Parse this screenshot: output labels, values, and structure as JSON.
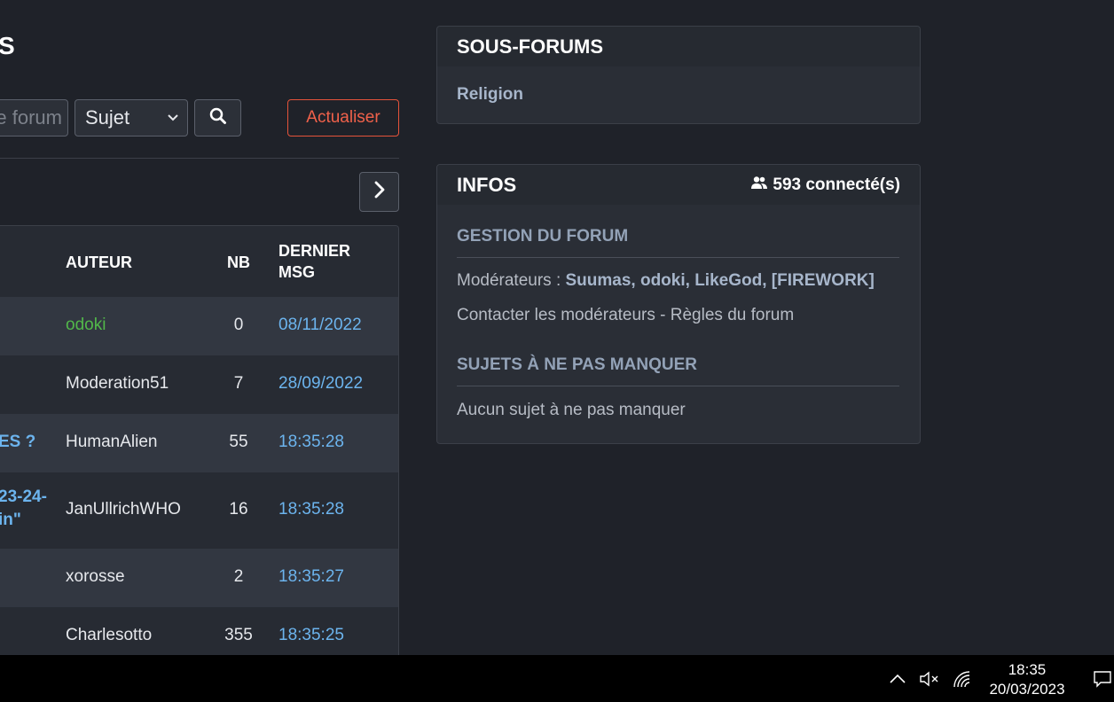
{
  "header": {
    "title_fragment": "s"
  },
  "toolbar": {
    "search_placeholder": "e forum",
    "select_value": "Sujet",
    "refresh_label": "Actualiser"
  },
  "table": {
    "columns": {
      "author": "AUTEUR",
      "nb": "NB",
      "last_line1": "DERNIER",
      "last_line2": "MSG"
    },
    "rows": [
      {
        "subject": "",
        "author": "odoki",
        "nb": "0",
        "date": "08/11/2022"
      },
      {
        "subject": "",
        "author": "Moderation51",
        "nb": "7",
        "date": "28/09/2022"
      },
      {
        "subject": "ES ?",
        "author": "HumanAlien",
        "nb": "55",
        "date": "18:35:28"
      },
      {
        "subject_line1": "23-24-",
        "subject_line2": "in\"",
        "author": "JanUllrichWHO",
        "nb": "16",
        "date": "18:35:28"
      },
      {
        "subject": "",
        "author": "xorosse",
        "nb": "2",
        "date": "18:35:27"
      },
      {
        "subject": "",
        "author": "Charlesotto",
        "nb": "355",
        "date": "18:35:25"
      }
    ]
  },
  "subforums": {
    "title": "SOUS-FORUMS",
    "items": [
      "Religion"
    ]
  },
  "infos": {
    "title": "INFOS",
    "online": "593 connecté(s)",
    "gestion_title": "GESTION DU FORUM",
    "moderators_label": "Modérateurs : ",
    "moderators": "Suumas, odoki, LikeGod, [FIREWORK]",
    "contact_line": "Contacter les modérateurs - Règles du forum",
    "must_read_title": "SUJETS À NE PAS MANQUER",
    "must_read_empty": "Aucun sujet à ne pas manquer"
  },
  "taskbar": {
    "time": "18:35",
    "date": "20/03/2023"
  },
  "colors": {
    "accent_link": "#6cb4ee",
    "refresh_red": "#f0614a",
    "author_green": "#52b84a"
  }
}
